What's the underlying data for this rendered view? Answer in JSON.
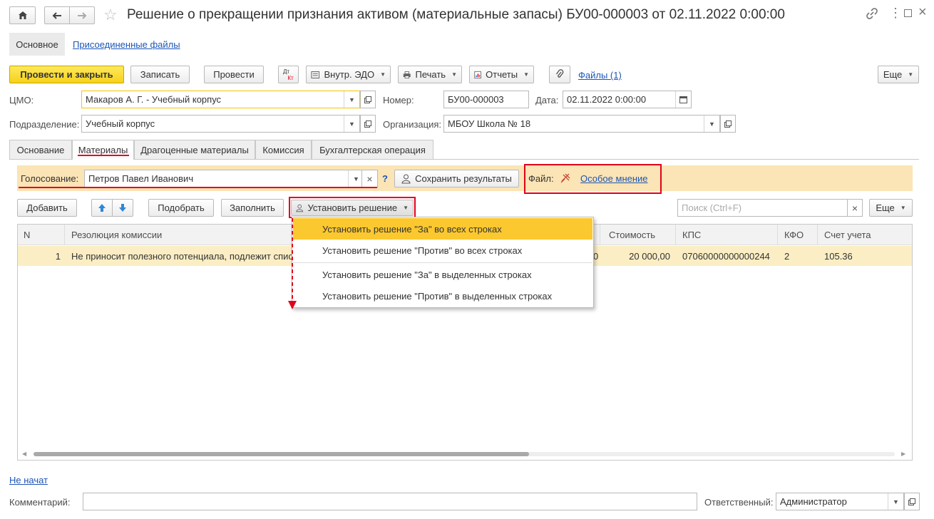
{
  "window": {
    "title": "Решение о прекращении признания активом (материальные запасы) БУ00-000003 от 02.11.2022 0:00:00"
  },
  "section_tabs": [
    "Основное",
    "Присоединенные файлы"
  ],
  "toolbar": {
    "post_close": "Провести и закрыть",
    "save": "Записать",
    "post": "Провести",
    "dt_kt_top": "Дт",
    "dt_kt_bottom": "Кт",
    "edo": "Внутр. ЭДО",
    "print": "Печать",
    "reports": "Отчеты",
    "files": "Файлы (1)",
    "more": "Еще"
  },
  "header_fields": {
    "cmo_label": "ЦМО:",
    "cmo_value": "Макаров А. Г. - Учебный корпус",
    "number_label": "Номер:",
    "number_value": "БУ00-000003",
    "date_label": "Дата:",
    "date_value": "02.11.2022  0:00:00",
    "division_label": "Подразделение:",
    "division_value": "Учебный корпус",
    "org_label": "Организация:",
    "org_value": "МБОУ Школа № 18"
  },
  "tabs": [
    "Основание",
    "Материалы",
    "Драгоценные материалы",
    "Комиссия",
    "Бухгалтерская операция"
  ],
  "voting": {
    "label": "Голосование:",
    "value": "Петров Павел Иванович",
    "help": "?",
    "save_results": "Сохранить результаты",
    "file_label": "Файл:",
    "file_link": "Особое мнение"
  },
  "table_toolbar": {
    "add": "Добавить",
    "pick": "Подобрать",
    "fill": "Заполнить",
    "set_decision": "Установить решение",
    "search_placeholder": "Поиск (Ctrl+F)",
    "more": "Еще"
  },
  "dropdown": {
    "items": [
      "Установить решение \"За\" во всех строках",
      "Установить решение \"Против\" во всех строках",
      "Установить решение \"За\" в выделенных строках",
      "Установить решение \"Против\" в выделенных строках"
    ]
  },
  "table": {
    "columns": [
      "N",
      "Резолюция комиссии",
      "Стоимость",
      "КПС",
      "КФО",
      "Счет учета"
    ],
    "rows": [
      {
        "n": "1",
        "resolution": "Не приносит полезного потенциала, подлежит спис",
        "qty_tail": "0",
        "cost": "20 000,00",
        "kps": "07060000000000244",
        "kfo": "2",
        "account": "105.36"
      }
    ]
  },
  "footer": {
    "status_link": "Не начат",
    "comment_label": "Комментарий:",
    "comment_value": "",
    "responsible_label": "Ответственный:",
    "responsible_value": "Администратор"
  },
  "colors": {
    "accent_yellow": "#f6d21c",
    "highlight_row": "#fbeec4",
    "voting_bar": "#fbe4b5",
    "menu_selected": "#fbc82f",
    "annotation_red": "#e3001b",
    "link_blue": "#1c56b7"
  }
}
